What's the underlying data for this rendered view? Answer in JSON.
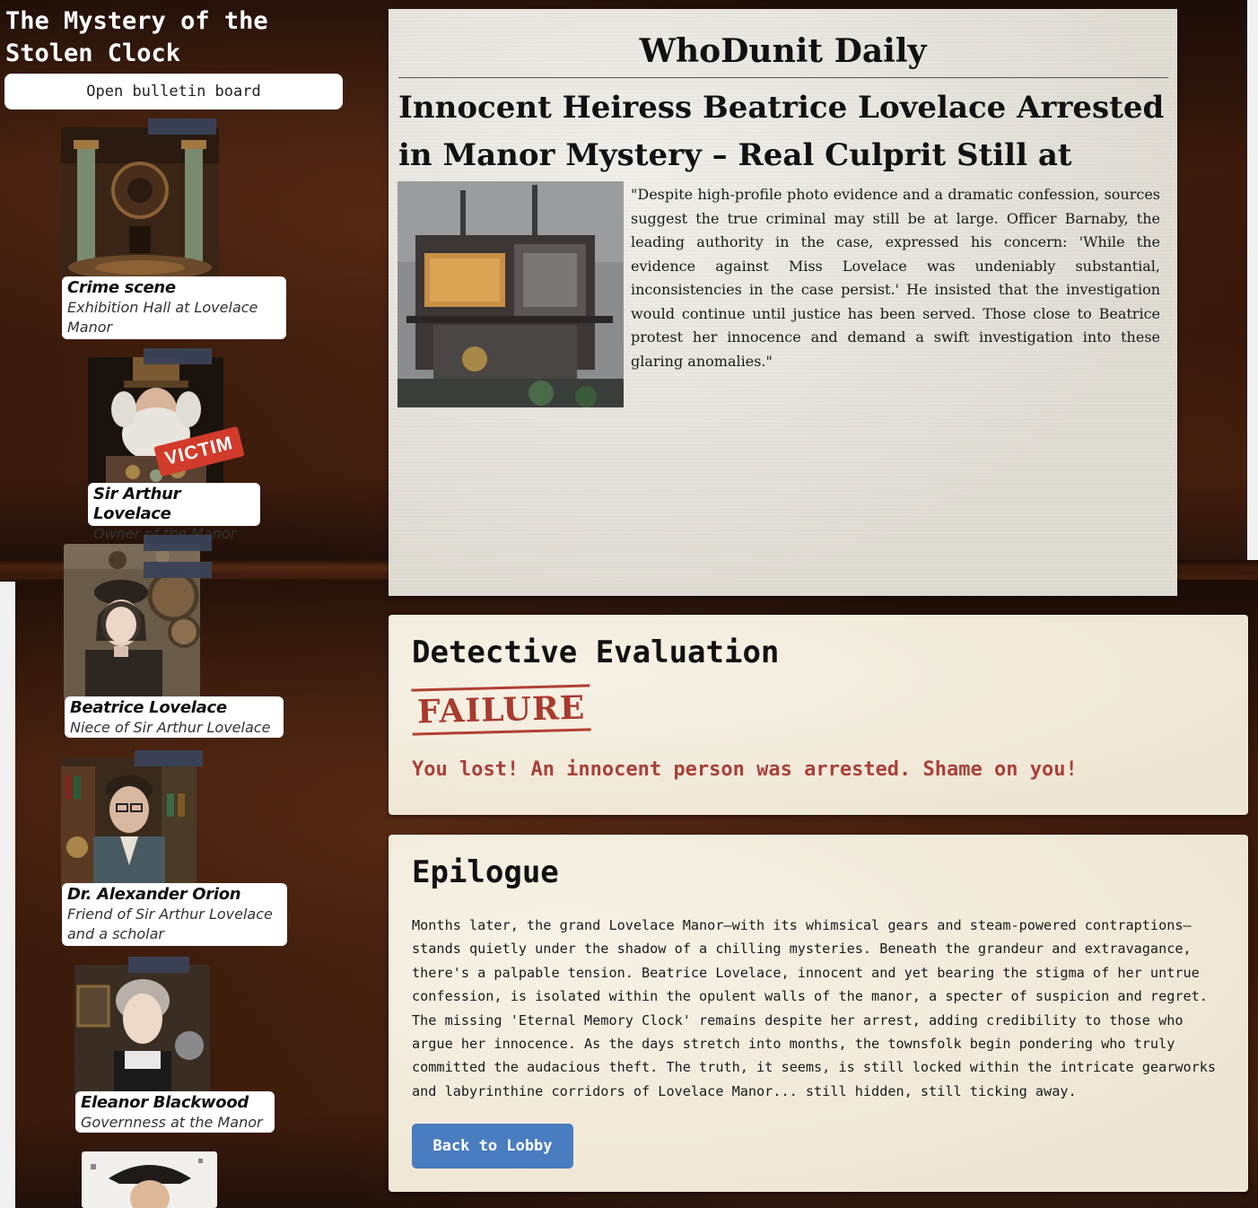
{
  "game": {
    "title": "The Mystery of the Stolen Clock",
    "bulletin_button": "Open bulletin board"
  },
  "sidebar": {
    "cards": [
      {
        "name": "Crime scene",
        "role": "Exhibition Hall at Lovelace Manor"
      },
      {
        "name": "Sir Arthur Lovelace",
        "role": "Owner of the Manor",
        "badge": "VICTIM"
      },
      {
        "name": "Beatrice Lovelace",
        "role": "Niece of Sir Arthur Lovelace"
      },
      {
        "name": "Dr. Alexander Orion",
        "role": "Friend of Sir Arthur Lovelace and a scholar"
      },
      {
        "name": "Eleanor Blackwood",
        "role": "Governness at the Manor"
      }
    ]
  },
  "newspaper": {
    "masthead": "WhoDunit Daily",
    "headline": "Innocent Heiress Beatrice Lovelace Arrested in Manor Mystery – Real Culprit Still at Large?",
    "body": "\"Despite high-profile photo evidence and a dramatic confession, sources suggest the true criminal may still be at large. Officer Barnaby, the leading authority in the case, expressed his concern: 'While the evidence against Miss Lovelace was undeniably substantial, inconsistencies in the case persist.' He insisted that the investigation would continue until justice has been served. Those close to Beatrice protest her innocence and demand a swift investigation into these glaring anomalies.\""
  },
  "evaluation": {
    "title": "Detective Evaluation",
    "stamp": "FAILURE",
    "message": "You lost! An innocent person was arrested. Shame on you!"
  },
  "epilogue": {
    "title": "Epilogue",
    "body": "Months later, the grand Lovelace Manor—with its whimsical gears and steam-powered contraptions—stands quietly under the shadow of a chilling mysteries. Beneath the grandeur and extravagance, there's a palpable tension. Beatrice Lovelace, innocent and yet bearing the stigma of her untrue confession, is isolated within the opulent walls of the manor, a specter of suspicion and regret. The missing 'Eternal Memory Clock' remains despite her arrest, adding credibility to those who argue her innocence. As the days stretch into months, the townsfolk begin pondering who truly committed the audacious theft. The truth, it seems, is still locked within the intricate gearworks and labyrinthine corridors of Lovelace Manor... still hidden, still ticking away.",
    "button": "Back to Lobby"
  },
  "colors": {
    "failure_red": "#a93a2f",
    "button_blue": "#4a7cc0",
    "victim_red": "#d23b2b"
  }
}
